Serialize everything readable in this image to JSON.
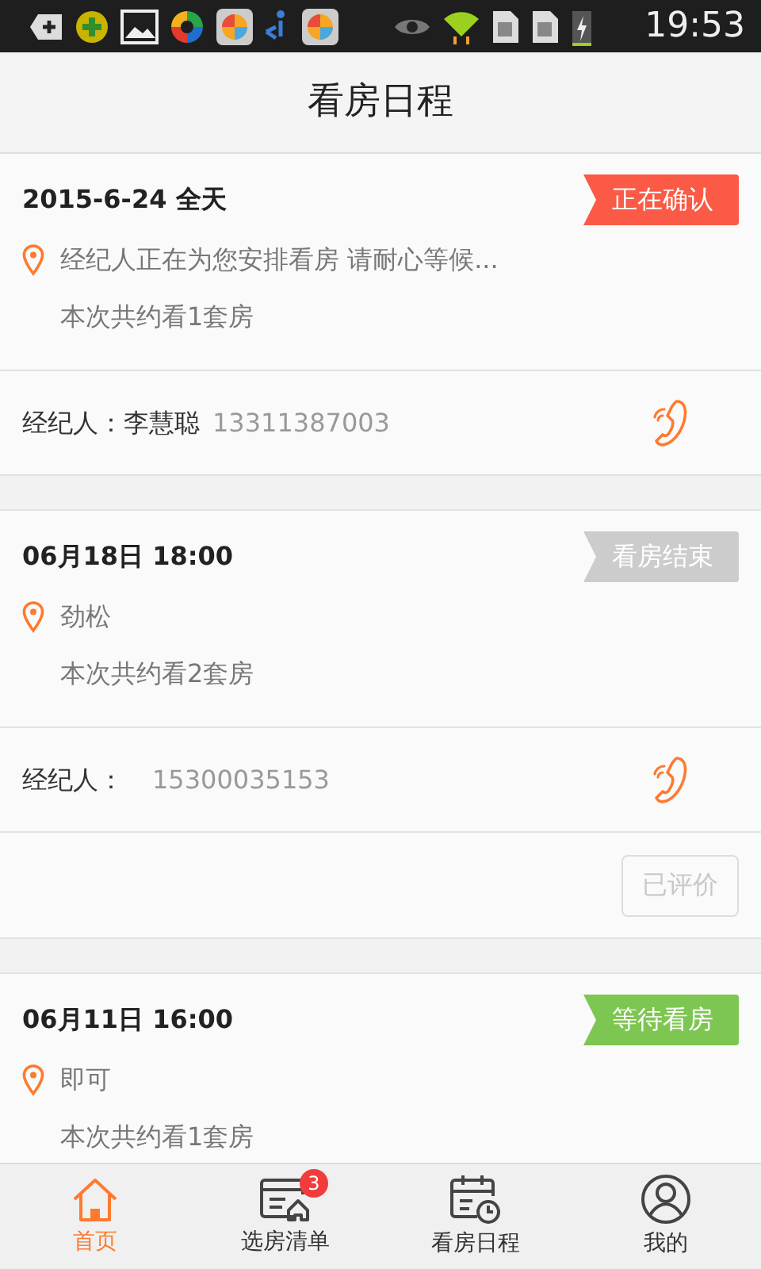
{
  "status_bar": {
    "time": "19:53"
  },
  "header": {
    "title": "看房日程"
  },
  "appointments": [
    {
      "date": "2015-6-24 全天",
      "status": "正在确认",
      "color": "#fa5a46",
      "location": "经纪人正在为您安排看房 请耐心等候...",
      "count": "本次共约看1套房",
      "agent_label": "经纪人：",
      "agent_name": "李慧聪",
      "phone": "13311387003"
    },
    {
      "date": "06月18日 18:00",
      "status": "看房结束",
      "color": "#cccccc",
      "location": "劲松",
      "count": "本次共约看2套房",
      "agent_label": "经纪人：",
      "phone": "15300035153",
      "review_button": {
        "label": "已评价",
        "disabled": true
      }
    },
    {
      "date": "06月11日 16:00",
      "status": "等待看房",
      "color": "#7ec652",
      "location": "即可",
      "count": "本次共约看1套房"
    }
  ],
  "tab_bar": [
    {
      "kind": "home",
      "label": "首页",
      "selected": true
    },
    {
      "kind": "list",
      "label": "选房清单",
      "selected": false,
      "badge": "3"
    },
    {
      "kind": "schedule",
      "label": "看房日程",
      "selected": false
    },
    {
      "kind": "profile",
      "label": "我的",
      "selected": false
    }
  ]
}
